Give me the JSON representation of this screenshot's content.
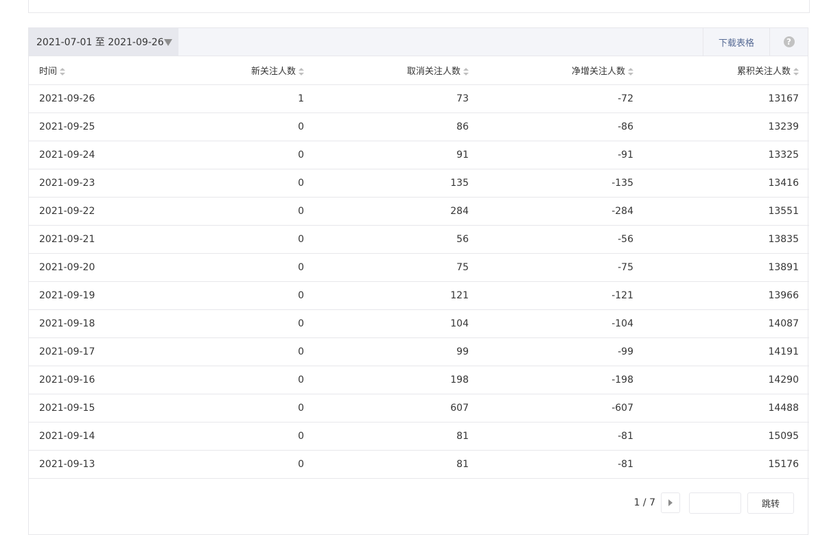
{
  "toolbar": {
    "date_range": "2021-07-01 至 2021-09-26",
    "download_label": "下载表格",
    "help_label": "?"
  },
  "table": {
    "headers": [
      "时间",
      "新关注人数",
      "取消关注人数",
      "净增关注人数",
      "累积关注人数"
    ],
    "rows": [
      [
        "2021-09-26",
        "1",
        "73",
        "-72",
        "13167"
      ],
      [
        "2021-09-25",
        "0",
        "86",
        "-86",
        "13239"
      ],
      [
        "2021-09-24",
        "0",
        "91",
        "-91",
        "13325"
      ],
      [
        "2021-09-23",
        "0",
        "135",
        "-135",
        "13416"
      ],
      [
        "2021-09-22",
        "0",
        "284",
        "-284",
        "13551"
      ],
      [
        "2021-09-21",
        "0",
        "56",
        "-56",
        "13835"
      ],
      [
        "2021-09-20",
        "0",
        "75",
        "-75",
        "13891"
      ],
      [
        "2021-09-19",
        "0",
        "121",
        "-121",
        "13966"
      ],
      [
        "2021-09-18",
        "0",
        "104",
        "-104",
        "14087"
      ],
      [
        "2021-09-17",
        "0",
        "99",
        "-99",
        "14191"
      ],
      [
        "2021-09-16",
        "0",
        "198",
        "-198",
        "14290"
      ],
      [
        "2021-09-15",
        "0",
        "607",
        "-607",
        "14488"
      ],
      [
        "2021-09-14",
        "0",
        "81",
        "-81",
        "15095"
      ],
      [
        "2021-09-13",
        "0",
        "81",
        "-81",
        "15176"
      ]
    ]
  },
  "pager": {
    "page_info": "1 / 7",
    "jump_input_value": "",
    "jump_label": "跳转"
  }
}
